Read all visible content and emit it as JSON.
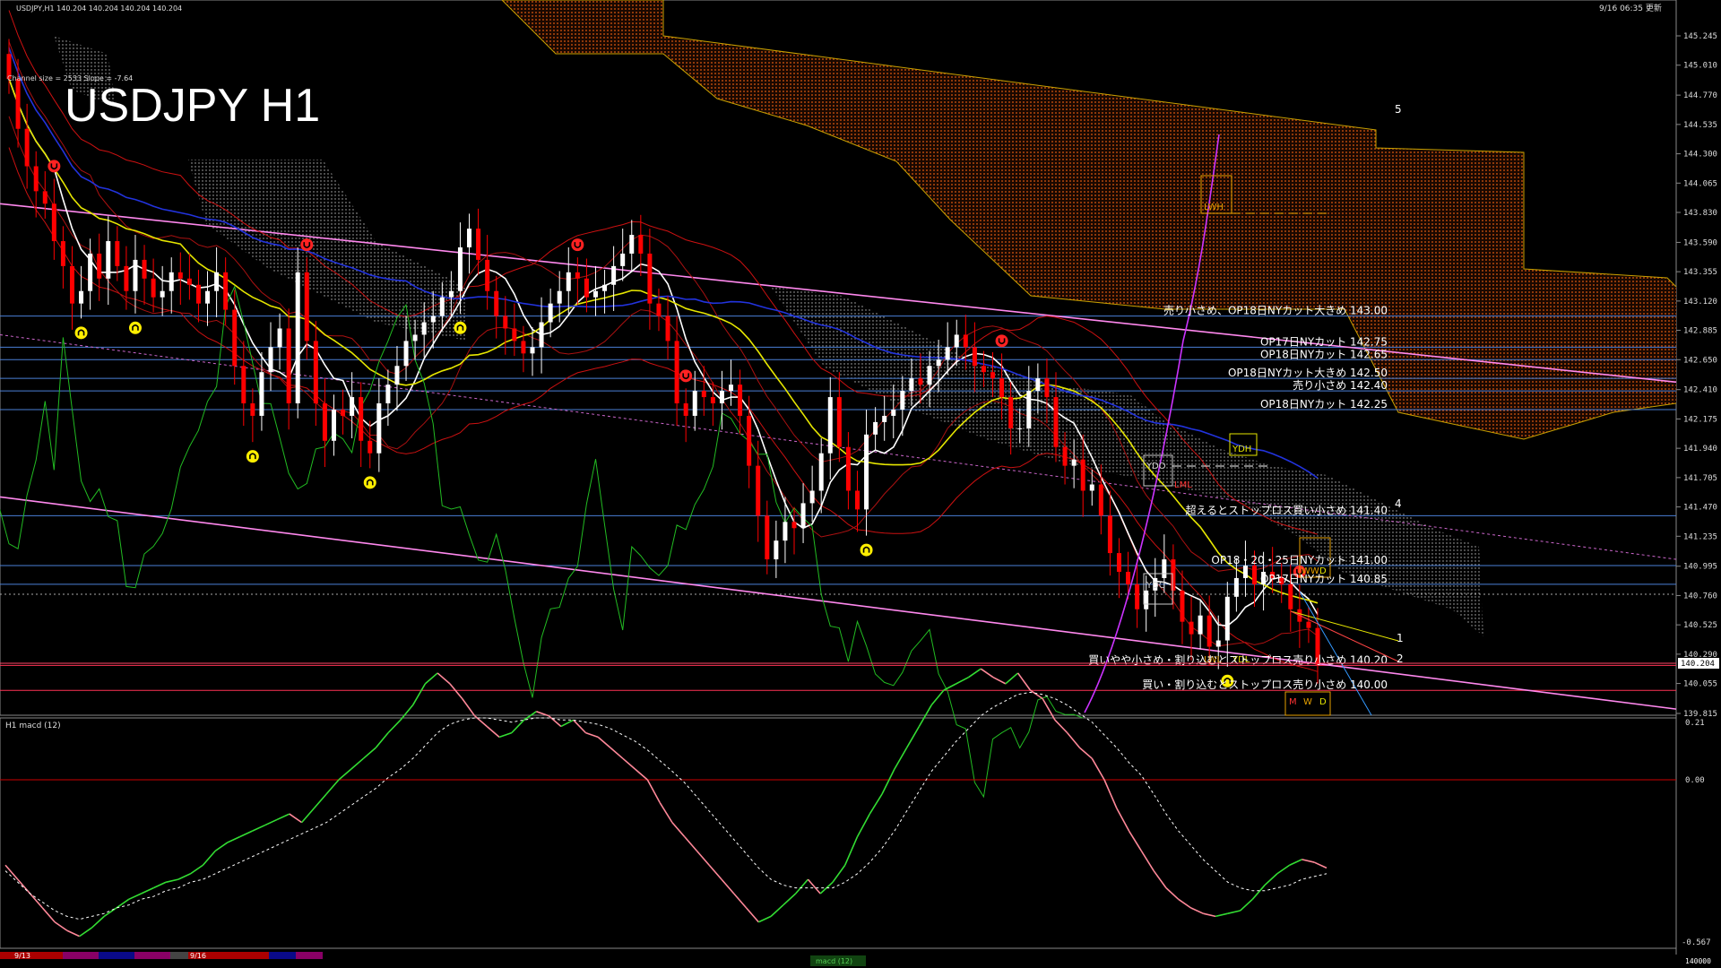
{
  "header": {
    "symbol_info": "USDJPY,H1  140.204 140.204 140.204 140.204",
    "timestamp": "9/16 06:35 更新",
    "channel_info": "Channel size = 2533 Slope = -7.64",
    "watermark": "USDJPY H1"
  },
  "price_axis": {
    "ticks": [
      "145.245",
      "145.010",
      "144.770",
      "144.535",
      "144.300",
      "144.065",
      "143.830",
      "143.590",
      "143.355",
      "143.120",
      "142.885",
      "142.650",
      "142.410",
      "142.175",
      "141.940",
      "141.705",
      "141.470",
      "141.235",
      "140.995",
      "140.760",
      "140.525",
      "140.290",
      "140.055",
      "139.815"
    ],
    "current_price": "140.204"
  },
  "macd_axis": {
    "ticks": [
      "0.21",
      "0.00",
      "-0.567"
    ],
    "panel_label": "H1  macd (12)"
  },
  "time_axis": {
    "labels": [
      "9/13",
      "9/16"
    ],
    "footer_right": "140000",
    "indicator_tab": "macd (12)"
  },
  "levels": [
    {
      "label": "売り小さめ、OP18日NYカット大きめ 143.00",
      "price": 143.0
    },
    {
      "label": "OP17日NYカット 142.75",
      "price": 142.75
    },
    {
      "label": "OP18日NYカット 142.65",
      "price": 142.65
    },
    {
      "label": "OP18日NYカット大きめ 142.50",
      "price": 142.5
    },
    {
      "label": "売り小さめ 142.40",
      "price": 142.4
    },
    {
      "label": "OP18日NYカット 142.25",
      "price": 142.25
    },
    {
      "label": "超えるとストップロス買い小さめ 141.40",
      "price": 141.4
    },
    {
      "label": "OP18・20・25日NYカット 141.00",
      "price": 141.0
    },
    {
      "label": "OP17日NYカット 140.85",
      "price": 140.85
    },
    {
      "label": "買いやや小さめ・割り込むとストップロス売り小さめ 140.20",
      "price": 140.2
    },
    {
      "label": "買い・割り込むとストップロス売り小さめ 140.00",
      "price": 140.0
    }
  ],
  "markers": [
    "LWH",
    "YDH",
    "YDO",
    "LML",
    "YDC",
    "LWL",
    "YDL",
    "WW",
    "D",
    "M",
    "W",
    "D"
  ],
  "wave_labels": [
    "4",
    "5",
    "1",
    "2"
  ],
  "chart_data": {
    "type": "candlestick",
    "symbol": "USDJPY",
    "timeframe": "H1",
    "ylim": [
      139.815,
      145.245
    ],
    "last_price": 140.204,
    "closes": [
      144.9,
      144.5,
      144.2,
      144.0,
      143.9,
      143.6,
      143.4,
      143.1,
      143.2,
      143.5,
      143.3,
      143.6,
      143.4,
      143.2,
      143.45,
      143.3,
      143.15,
      143.2,
      143.35,
      143.3,
      143.25,
      143.1,
      143.2,
      143.35,
      143.05,
      142.6,
      142.3,
      142.2,
      142.55,
      142.75,
      142.9,
      142.3,
      143.35,
      142.8,
      142.3,
      142.0,
      142.25,
      142.2,
      142.35,
      142.0,
      141.9,
      142.3,
      142.45,
      142.6,
      142.8,
      142.85,
      142.95,
      143.0,
      143.15,
      143.2,
      143.55,
      143.7,
      143.45,
      143.2,
      143.0,
      142.9,
      142.8,
      142.7,
      142.75,
      142.95,
      143.1,
      143.2,
      143.35,
      143.3,
      143.15,
      143.2,
      143.25,
      143.4,
      143.5,
      143.65,
      143.5,
      143.1,
      143.0,
      142.8,
      142.3,
      142.2,
      142.4,
      142.35,
      142.3,
      142.4,
      142.45,
      142.2,
      141.8,
      141.4,
      141.05,
      141.2,
      141.35,
      141.3,
      141.5,
      141.6,
      141.9,
      142.35,
      141.95,
      141.6,
      141.45,
      142.05,
      142.15,
      142.2,
      142.25,
      142.4,
      142.5,
      142.45,
      142.6,
      142.65,
      142.75,
      142.85,
      142.75,
      142.6,
      142.55,
      142.5,
      142.35,
      142.1,
      142.1,
      142.4,
      142.5,
      142.35,
      141.95,
      141.8,
      141.85,
      141.6,
      141.65,
      141.4,
      141.1,
      140.95,
      140.85,
      140.65,
      140.8,
      140.9,
      141.05,
      140.8,
      140.55,
      140.45,
      140.6,
      140.35,
      140.4,
      140.75,
      140.9,
      141.0,
      140.85,
      140.95,
      140.9,
      140.85,
      140.65,
      140.55,
      140.5,
      140.204
    ],
    "macd": [
      -0.3,
      -0.35,
      -0.4,
      -0.45,
      -0.5,
      -0.53,
      -0.55,
      -0.52,
      -0.48,
      -0.45,
      -0.42,
      -0.4,
      -0.38,
      -0.36,
      -0.35,
      -0.33,
      -0.3,
      -0.25,
      -0.22,
      -0.2,
      -0.18,
      -0.16,
      -0.14,
      -0.12,
      -0.15,
      -0.1,
      -0.05,
      0.0,
      0.05,
      0.1,
      0.15,
      0.22,
      0.28,
      0.35,
      0.45,
      0.5,
      0.45,
      0.38,
      0.3,
      0.25,
      0.2,
      0.22,
      0.28,
      0.32,
      0.3,
      0.25,
      0.28,
      0.22,
      0.2,
      0.15,
      0.1,
      0.05,
      0.0,
      -0.08,
      -0.15,
      -0.2,
      -0.25,
      -0.3,
      -0.35,
      -0.4,
      -0.45,
      -0.5,
      -0.48,
      -0.44,
      -0.4,
      -0.35,
      -0.4,
      -0.36,
      -0.3,
      -0.2,
      -0.12,
      -0.05,
      0.05,
      0.15,
      0.25,
      0.35,
      0.42,
      0.45,
      0.48,
      0.52,
      0.48,
      0.45,
      0.5,
      0.42,
      0.38,
      0.28,
      0.22,
      0.15,
      0.1,
      0.0,
      -0.1,
      -0.18,
      -0.25,
      -0.32,
      -0.38,
      -0.42,
      -0.45,
      -0.47,
      -0.48,
      -0.47,
      -0.46,
      -0.42,
      -0.37,
      -0.33,
      -0.3,
      -0.28,
      -0.29,
      -0.31
    ],
    "macd_signal": [
      -0.32,
      -0.36,
      -0.4,
      -0.43,
      -0.46,
      -0.48,
      -0.49,
      -0.48,
      -0.47,
      -0.45,
      -0.44,
      -0.42,
      -0.41,
      -0.39,
      -0.38,
      -0.36,
      -0.35,
      -0.33,
      -0.31,
      -0.29,
      -0.27,
      -0.25,
      -0.23,
      -0.21,
      -0.19,
      -0.17,
      -0.15,
      -0.12,
      -0.09,
      -0.06,
      -0.03,
      0.01,
      0.05,
      0.1,
      0.16,
      0.22,
      0.26,
      0.28,
      0.29,
      0.29,
      0.28,
      0.27,
      0.28,
      0.29,
      0.29,
      0.28,
      0.28,
      0.27,
      0.26,
      0.24,
      0.21,
      0.18,
      0.14,
      0.09,
      0.04,
      -0.01,
      -0.06,
      -0.11,
      -0.16,
      -0.21,
      -0.26,
      -0.31,
      -0.35,
      -0.37,
      -0.38,
      -0.38,
      -0.38,
      -0.38,
      -0.36,
      -0.33,
      -0.29,
      -0.24,
      -0.18,
      -0.11,
      -0.04,
      0.04,
      0.11,
      0.18,
      0.24,
      0.3,
      0.34,
      0.37,
      0.4,
      0.41,
      0.4,
      0.38,
      0.35,
      0.31,
      0.27,
      0.21,
      0.15,
      0.08,
      0.02,
      -0.05,
      -0.12,
      -0.18,
      -0.23,
      -0.28,
      -0.32,
      -0.36,
      -0.38,
      -0.39,
      -0.39,
      -0.38,
      -0.37,
      -0.35,
      -0.34,
      -0.33
    ],
    "channel": {
      "upper": [
        143.9,
        142.47
      ],
      "lower": [
        141.55,
        139.85
      ]
    }
  },
  "colors": {
    "bull": "#ffffff",
    "bear": "#ff0000",
    "ma_white": "#ffffff",
    "ma_yellow": "#e6e600",
    "ma_blue": "#2233dd",
    "level_line": "#4a7fd6",
    "channel": "#ff88ee",
    "macd_up": "#33dd33",
    "macd_down": "#ff8899",
    "cloud": "#c86400",
    "ichimoku_lagging": "#22bb22"
  }
}
